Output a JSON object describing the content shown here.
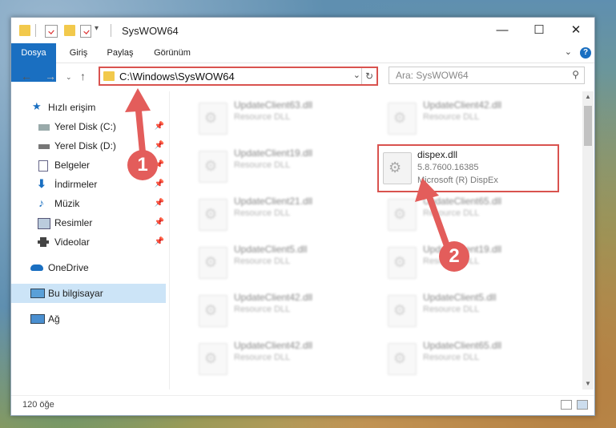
{
  "window": {
    "title": "SysWOW64",
    "controls": {
      "minimize": "—",
      "maximize": "☐",
      "close": "✕"
    }
  },
  "ribbon": {
    "tabs": [
      "Dosya",
      "Giriş",
      "Paylaş",
      "Görünüm"
    ],
    "help": "?"
  },
  "address": {
    "path": "C:\\Windows\\SysWOW64",
    "search_placeholder": "Ara: SysWOW64"
  },
  "sidebar": {
    "items": [
      {
        "label": "Hızlı erişim",
        "icon": "star-icon"
      },
      {
        "label": "Yerel Disk (C:)",
        "icon": "drive-icon"
      },
      {
        "label": "Yerel Disk (D:)",
        "icon": "drive-icon"
      },
      {
        "label": "Belgeler",
        "icon": "documents-icon"
      },
      {
        "label": "İndirmeler",
        "icon": "download-icon"
      },
      {
        "label": "Müzik",
        "icon": "music-icon"
      },
      {
        "label": "Resimler",
        "icon": "pictures-icon"
      },
      {
        "label": "Videolar",
        "icon": "video-icon"
      },
      {
        "label": "OneDrive",
        "icon": "cloud-icon"
      },
      {
        "label": "Bu bilgisayar",
        "icon": "computer-icon"
      },
      {
        "label": "Ağ",
        "icon": "network-icon"
      }
    ]
  },
  "files": {
    "left": [
      {
        "name": "UpdateClient63.dll",
        "desc": "Resource DLL"
      },
      {
        "name": "UpdateClient19.dll",
        "desc": "Resource DLL"
      },
      {
        "name": "UpdateClient21.dll",
        "desc": "Resource DLL"
      },
      {
        "name": "UpdateClient5.dll",
        "desc": "Resource DLL"
      },
      {
        "name": "UpdateClient42.dll",
        "desc": "Resource DLL"
      },
      {
        "name": "UpdateClient42.dll",
        "desc": "Resource DLL"
      }
    ],
    "right": [
      {
        "name": "UpdateClient42.dll",
        "desc": "Resource DLL"
      },
      {
        "name": "dispex.dll",
        "desc": "5.8.7600.16385",
        "desc2": "Microsoft (R) DispEx"
      },
      {
        "name": "UpdateClient65.dll",
        "desc": "Resource DLL"
      },
      {
        "name": "UpdateClient19.dll",
        "desc": "Resource DLL"
      },
      {
        "name": "UpdateClient5.dll",
        "desc": "Resource DLL"
      },
      {
        "name": "UpdateClient65.dll",
        "desc": "Resource DLL"
      }
    ]
  },
  "status": {
    "count": "120 öğe"
  },
  "markers": {
    "one": "1",
    "two": "2"
  },
  "colors": {
    "accent": "#1a6fc1",
    "highlight": "#d9534f",
    "marker": "#e35d5b"
  }
}
